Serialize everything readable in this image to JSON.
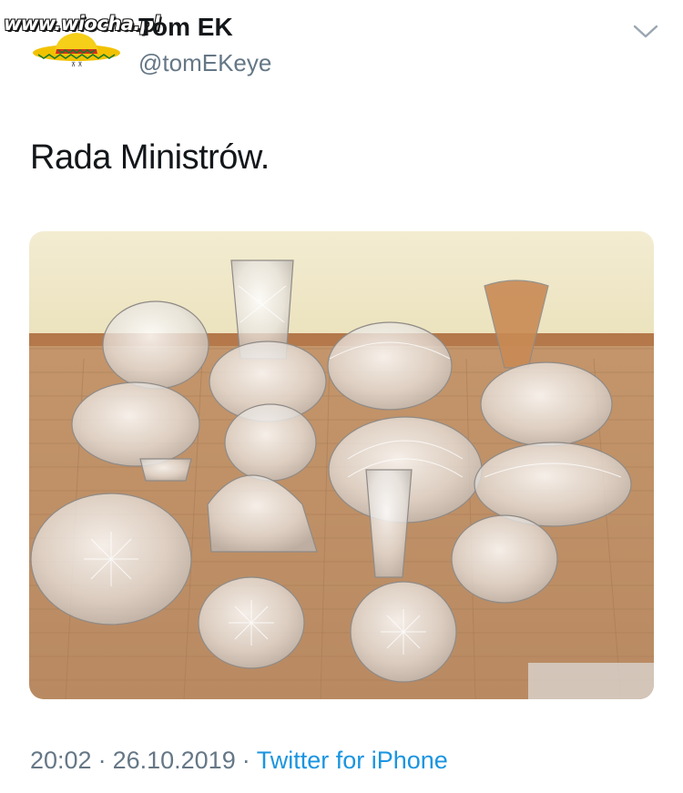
{
  "watermark": {
    "text": "www.wiocha.pl"
  },
  "tweet": {
    "display_name": "Tom EK",
    "handle": "@tomEKeye",
    "text": "Rada Ministrów.",
    "time": "20:02",
    "date": "26.10.2019",
    "separator": "·",
    "source": "Twitter for iPhone"
  },
  "icons": {
    "menu": "chevron-down-icon"
  },
  "colors": {
    "link": "#1b95e0",
    "secondary": "#657786",
    "text": "#14171a"
  }
}
